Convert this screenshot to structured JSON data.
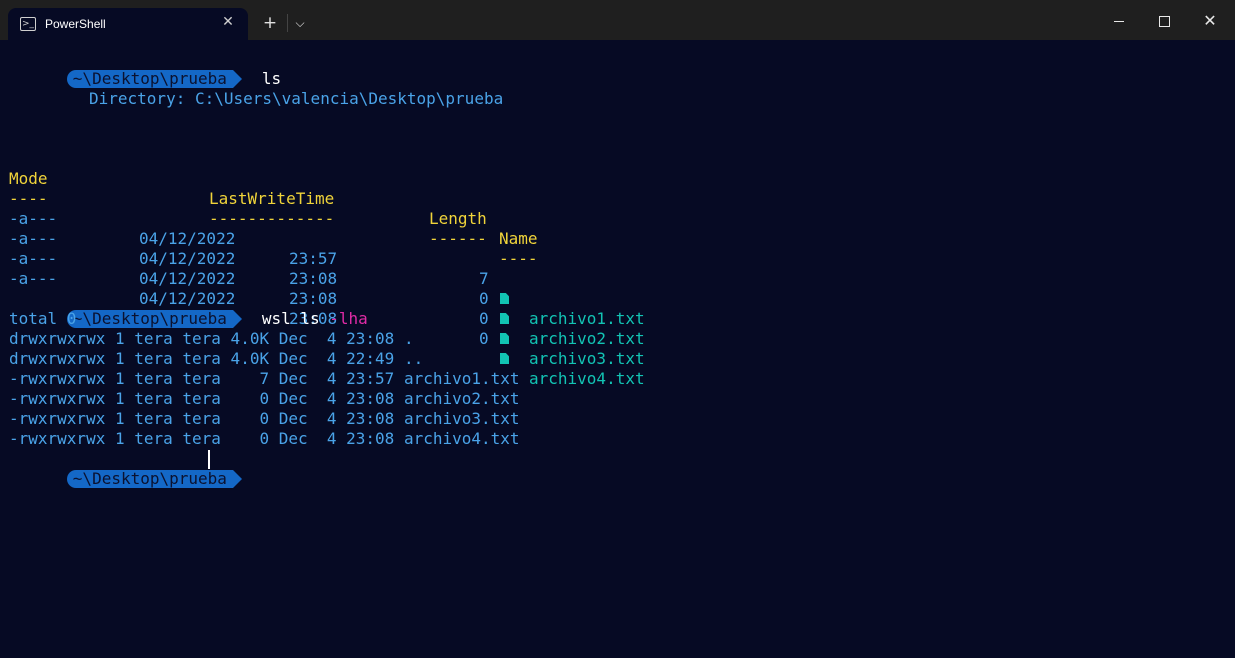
{
  "window": {
    "tab_title": "PowerShell",
    "tab_icon": "powershell-icon",
    "new_tab": "+",
    "dropdown": "⌵",
    "close": "✕",
    "window_close": "✕"
  },
  "prompt": "~\\Desktop\\prueba",
  "cmd1": "ls",
  "directory_line": "Directory: C:\\Users\\valencia\\Desktop\\prueba",
  "headers": {
    "mode": "Mode",
    "lwt": "LastWriteTime",
    "length": "Length",
    "name": "Name"
  },
  "underlines": {
    "mode": "----",
    "lwt": "-------------",
    "length": "------",
    "name": "----"
  },
  "files": [
    {
      "mode": "-a---",
      "date": "04/12/2022",
      "time": "23:57",
      "length": "7",
      "name": "archivo1.txt"
    },
    {
      "mode": "-a---",
      "date": "04/12/2022",
      "time": "23:08",
      "length": "0",
      "name": "archivo2.txt"
    },
    {
      "mode": "-a---",
      "date": "04/12/2022",
      "time": "23:08",
      "length": "0",
      "name": "archivo3.txt"
    },
    {
      "mode": "-a---",
      "date": "04/12/2022",
      "time": "23:08",
      "length": "0",
      "name": "archivo4.txt"
    }
  ],
  "cmd2": {
    "main": "wsl ls ",
    "flag": "-lha"
  },
  "wsl_output": [
    "total 0",
    "drwxrwxrwx 1 tera tera 4.0K Dec  4 23:08 .",
    "drwxrwxrwx 1 tera tera 4.0K Dec  4 22:49 ..",
    "-rwxrwxrwx 1 tera tera    7 Dec  4 23:57 archivo1.txt",
    "-rwxrwxrwx 1 tera tera    0 Dec  4 23:08 archivo2.txt",
    "-rwxrwxrwx 1 tera tera    0 Dec  4 23:08 archivo3.txt",
    "-rwxrwxrwx 1 tera tera    0 Dec  4 23:08 archivo4.txt"
  ],
  "colors": {
    "background": "#060a24",
    "prompt_bg": "#1468c7",
    "text_blue": "#4aa3e8",
    "header_yellow": "#f0d43a",
    "file_teal": "#12c4b4",
    "flag_magenta": "#e02ba6"
  }
}
